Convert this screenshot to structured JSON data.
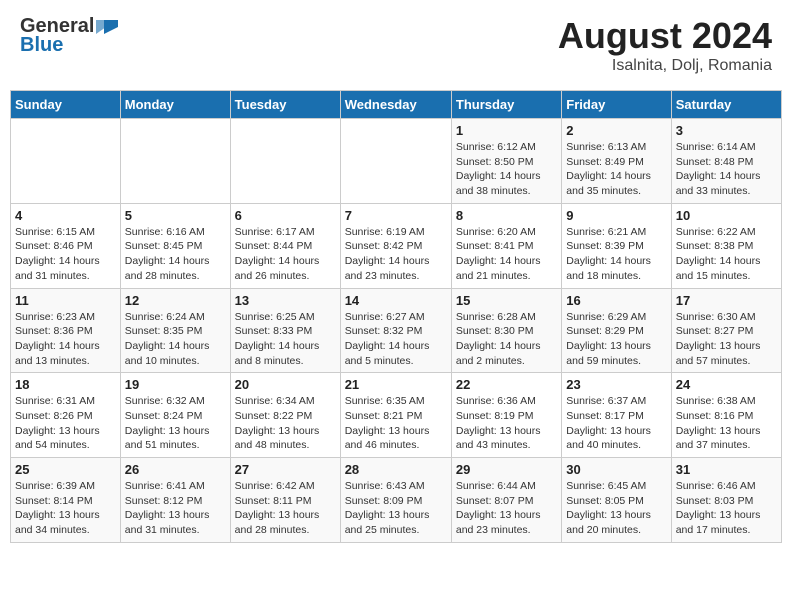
{
  "header": {
    "logo_general": "General",
    "logo_blue": "Blue",
    "title": "August 2024",
    "subtitle": "Isalnita, Dolj, Romania"
  },
  "days_of_week": [
    "Sunday",
    "Monday",
    "Tuesday",
    "Wednesday",
    "Thursday",
    "Friday",
    "Saturday"
  ],
  "weeks": [
    [
      {
        "day": "",
        "info": ""
      },
      {
        "day": "",
        "info": ""
      },
      {
        "day": "",
        "info": ""
      },
      {
        "day": "",
        "info": ""
      },
      {
        "day": "1",
        "info": "Sunrise: 6:12 AM\nSunset: 8:50 PM\nDaylight: 14 hours and 38 minutes."
      },
      {
        "day": "2",
        "info": "Sunrise: 6:13 AM\nSunset: 8:49 PM\nDaylight: 14 hours and 35 minutes."
      },
      {
        "day": "3",
        "info": "Sunrise: 6:14 AM\nSunset: 8:48 PM\nDaylight: 14 hours and 33 minutes."
      }
    ],
    [
      {
        "day": "4",
        "info": "Sunrise: 6:15 AM\nSunset: 8:46 PM\nDaylight: 14 hours and 31 minutes."
      },
      {
        "day": "5",
        "info": "Sunrise: 6:16 AM\nSunset: 8:45 PM\nDaylight: 14 hours and 28 minutes."
      },
      {
        "day": "6",
        "info": "Sunrise: 6:17 AM\nSunset: 8:44 PM\nDaylight: 14 hours and 26 minutes."
      },
      {
        "day": "7",
        "info": "Sunrise: 6:19 AM\nSunset: 8:42 PM\nDaylight: 14 hours and 23 minutes."
      },
      {
        "day": "8",
        "info": "Sunrise: 6:20 AM\nSunset: 8:41 PM\nDaylight: 14 hours and 21 minutes."
      },
      {
        "day": "9",
        "info": "Sunrise: 6:21 AM\nSunset: 8:39 PM\nDaylight: 14 hours and 18 minutes."
      },
      {
        "day": "10",
        "info": "Sunrise: 6:22 AM\nSunset: 8:38 PM\nDaylight: 14 hours and 15 minutes."
      }
    ],
    [
      {
        "day": "11",
        "info": "Sunrise: 6:23 AM\nSunset: 8:36 PM\nDaylight: 14 hours and 13 minutes."
      },
      {
        "day": "12",
        "info": "Sunrise: 6:24 AM\nSunset: 8:35 PM\nDaylight: 14 hours and 10 minutes."
      },
      {
        "day": "13",
        "info": "Sunrise: 6:25 AM\nSunset: 8:33 PM\nDaylight: 14 hours and 8 minutes."
      },
      {
        "day": "14",
        "info": "Sunrise: 6:27 AM\nSunset: 8:32 PM\nDaylight: 14 hours and 5 minutes."
      },
      {
        "day": "15",
        "info": "Sunrise: 6:28 AM\nSunset: 8:30 PM\nDaylight: 14 hours and 2 minutes."
      },
      {
        "day": "16",
        "info": "Sunrise: 6:29 AM\nSunset: 8:29 PM\nDaylight: 13 hours and 59 minutes."
      },
      {
        "day": "17",
        "info": "Sunrise: 6:30 AM\nSunset: 8:27 PM\nDaylight: 13 hours and 57 minutes."
      }
    ],
    [
      {
        "day": "18",
        "info": "Sunrise: 6:31 AM\nSunset: 8:26 PM\nDaylight: 13 hours and 54 minutes."
      },
      {
        "day": "19",
        "info": "Sunrise: 6:32 AM\nSunset: 8:24 PM\nDaylight: 13 hours and 51 minutes."
      },
      {
        "day": "20",
        "info": "Sunrise: 6:34 AM\nSunset: 8:22 PM\nDaylight: 13 hours and 48 minutes."
      },
      {
        "day": "21",
        "info": "Sunrise: 6:35 AM\nSunset: 8:21 PM\nDaylight: 13 hours and 46 minutes."
      },
      {
        "day": "22",
        "info": "Sunrise: 6:36 AM\nSunset: 8:19 PM\nDaylight: 13 hours and 43 minutes."
      },
      {
        "day": "23",
        "info": "Sunrise: 6:37 AM\nSunset: 8:17 PM\nDaylight: 13 hours and 40 minutes."
      },
      {
        "day": "24",
        "info": "Sunrise: 6:38 AM\nSunset: 8:16 PM\nDaylight: 13 hours and 37 minutes."
      }
    ],
    [
      {
        "day": "25",
        "info": "Sunrise: 6:39 AM\nSunset: 8:14 PM\nDaylight: 13 hours and 34 minutes."
      },
      {
        "day": "26",
        "info": "Sunrise: 6:41 AM\nSunset: 8:12 PM\nDaylight: 13 hours and 31 minutes."
      },
      {
        "day": "27",
        "info": "Sunrise: 6:42 AM\nSunset: 8:11 PM\nDaylight: 13 hours and 28 minutes."
      },
      {
        "day": "28",
        "info": "Sunrise: 6:43 AM\nSunset: 8:09 PM\nDaylight: 13 hours and 25 minutes."
      },
      {
        "day": "29",
        "info": "Sunrise: 6:44 AM\nSunset: 8:07 PM\nDaylight: 13 hours and 23 minutes."
      },
      {
        "day": "30",
        "info": "Sunrise: 6:45 AM\nSunset: 8:05 PM\nDaylight: 13 hours and 20 minutes."
      },
      {
        "day": "31",
        "info": "Sunrise: 6:46 AM\nSunset: 8:03 PM\nDaylight: 13 hours and 17 minutes."
      }
    ]
  ]
}
